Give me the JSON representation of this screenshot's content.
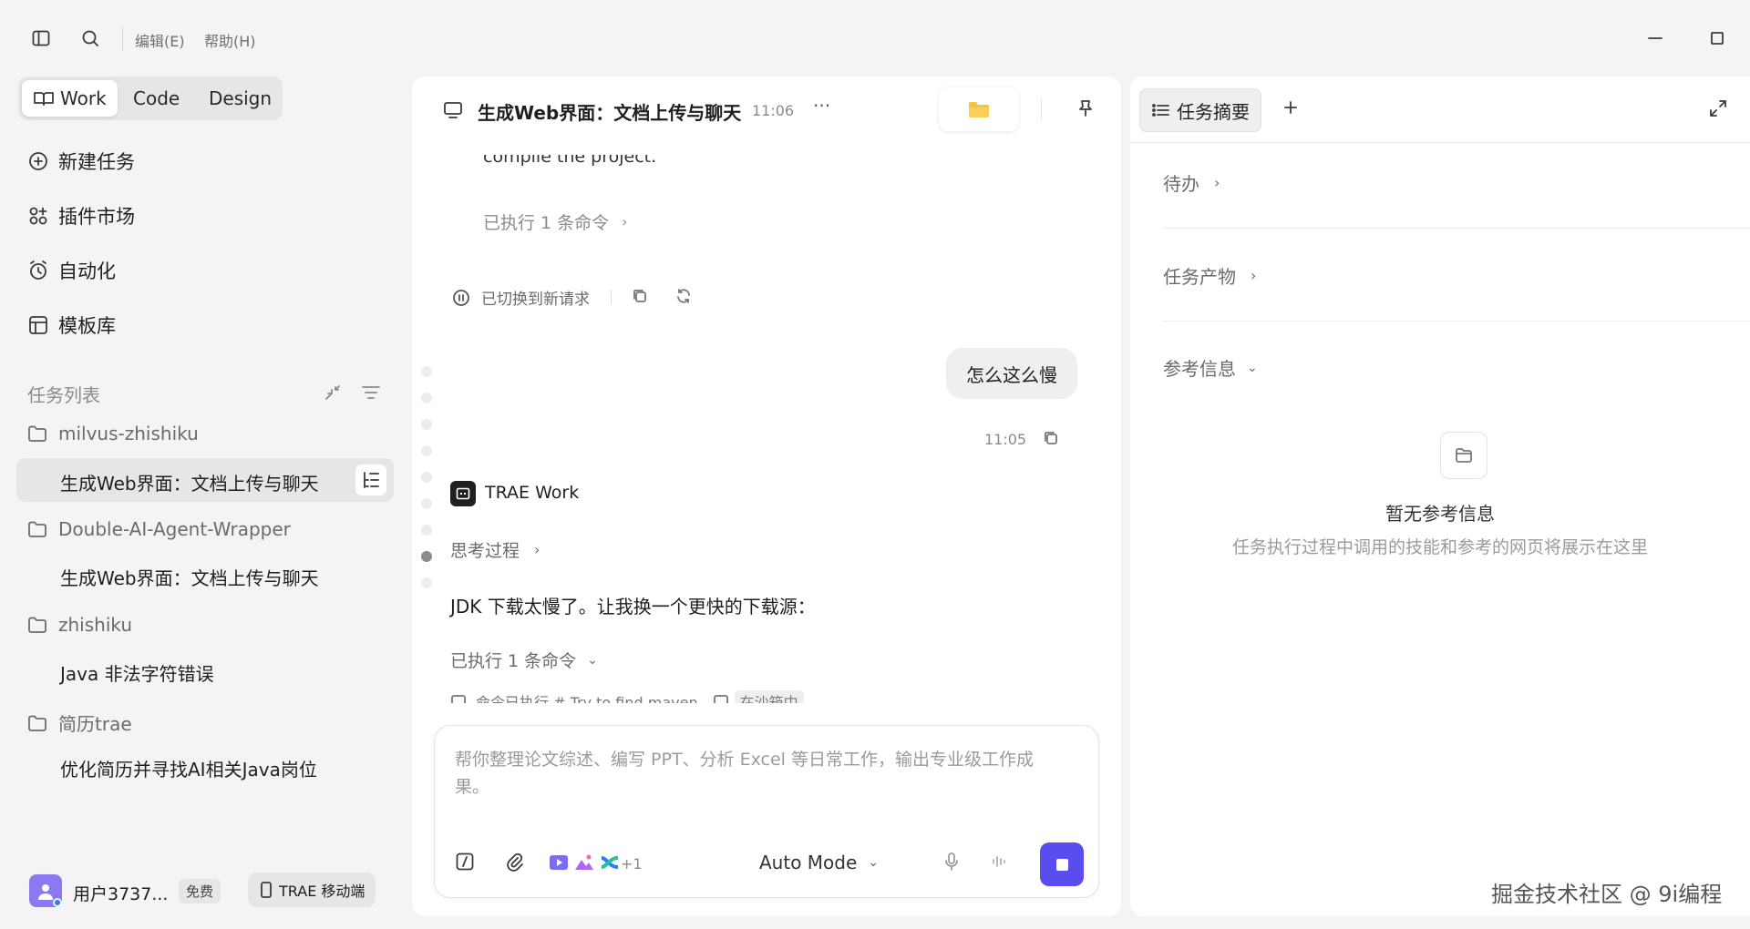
{
  "menu": {
    "edit": "编辑(E)",
    "help": "帮助(H)"
  },
  "modes": {
    "work": "Work",
    "code": "Code",
    "design": "Design"
  },
  "nav": {
    "new_task": "新建任务",
    "plugins": "插件市场",
    "automation": "自动化",
    "templates": "模板库"
  },
  "task_list": {
    "title": "任务列表",
    "projects": [
      {
        "name": "milvus-zhishiku",
        "tasks": [
          "生成Web界面：文档上传与聊天"
        ]
      },
      {
        "name": "Double-AI-Agent-Wrapper",
        "tasks": [
          "生成Web界面：文档上传与聊天"
        ]
      },
      {
        "name": "zhishiku",
        "tasks": [
          "Java 非法字符错误"
        ]
      },
      {
        "name": "简历trae",
        "tasks": [
          "优化简历并寻找AI相关Java岗位"
        ]
      }
    ]
  },
  "user": {
    "name": "用户3737...",
    "plan": "免费",
    "mobile": "TRAE 移动端"
  },
  "chat": {
    "title": "生成Web界面：文档上传与聊天",
    "time": "11:06",
    "more": "···",
    "partial_text": "compile the project.",
    "executed_1": "已执行 1 条命令",
    "switched": "已切换到新请求",
    "user_msg": "怎么这么慢",
    "user_msg_time": "11:05",
    "agent_name": "TRAE Work",
    "thinking": "思考过程",
    "agent_text": "JDK 下载太慢了。让我换一个更快的下载源：",
    "executed_2": "已执行 1 条命令",
    "partial_bottom": "命令已执行  # Try to find maven",
    "partial_chip": "在沙箱中",
    "input_placeholder": "帮你整理论文综述、编写 PPT、分析 Excel 等日常工作，输出专业级工作成果。",
    "plus_count": "+1",
    "mode_select": "Auto Mode"
  },
  "right": {
    "tab": "任务摘要",
    "todo": "待办",
    "artifacts": "任务产物",
    "references": "参考信息",
    "empty_title": "暂无参考信息",
    "empty_desc": "任务执行过程中调用的技能和参考的网页将展示在这里"
  },
  "watermark": "掘金技术社区 @ 9i编程",
  "colors": {
    "accent": "#5b4cf0",
    "bg": "#f4f4f5"
  }
}
